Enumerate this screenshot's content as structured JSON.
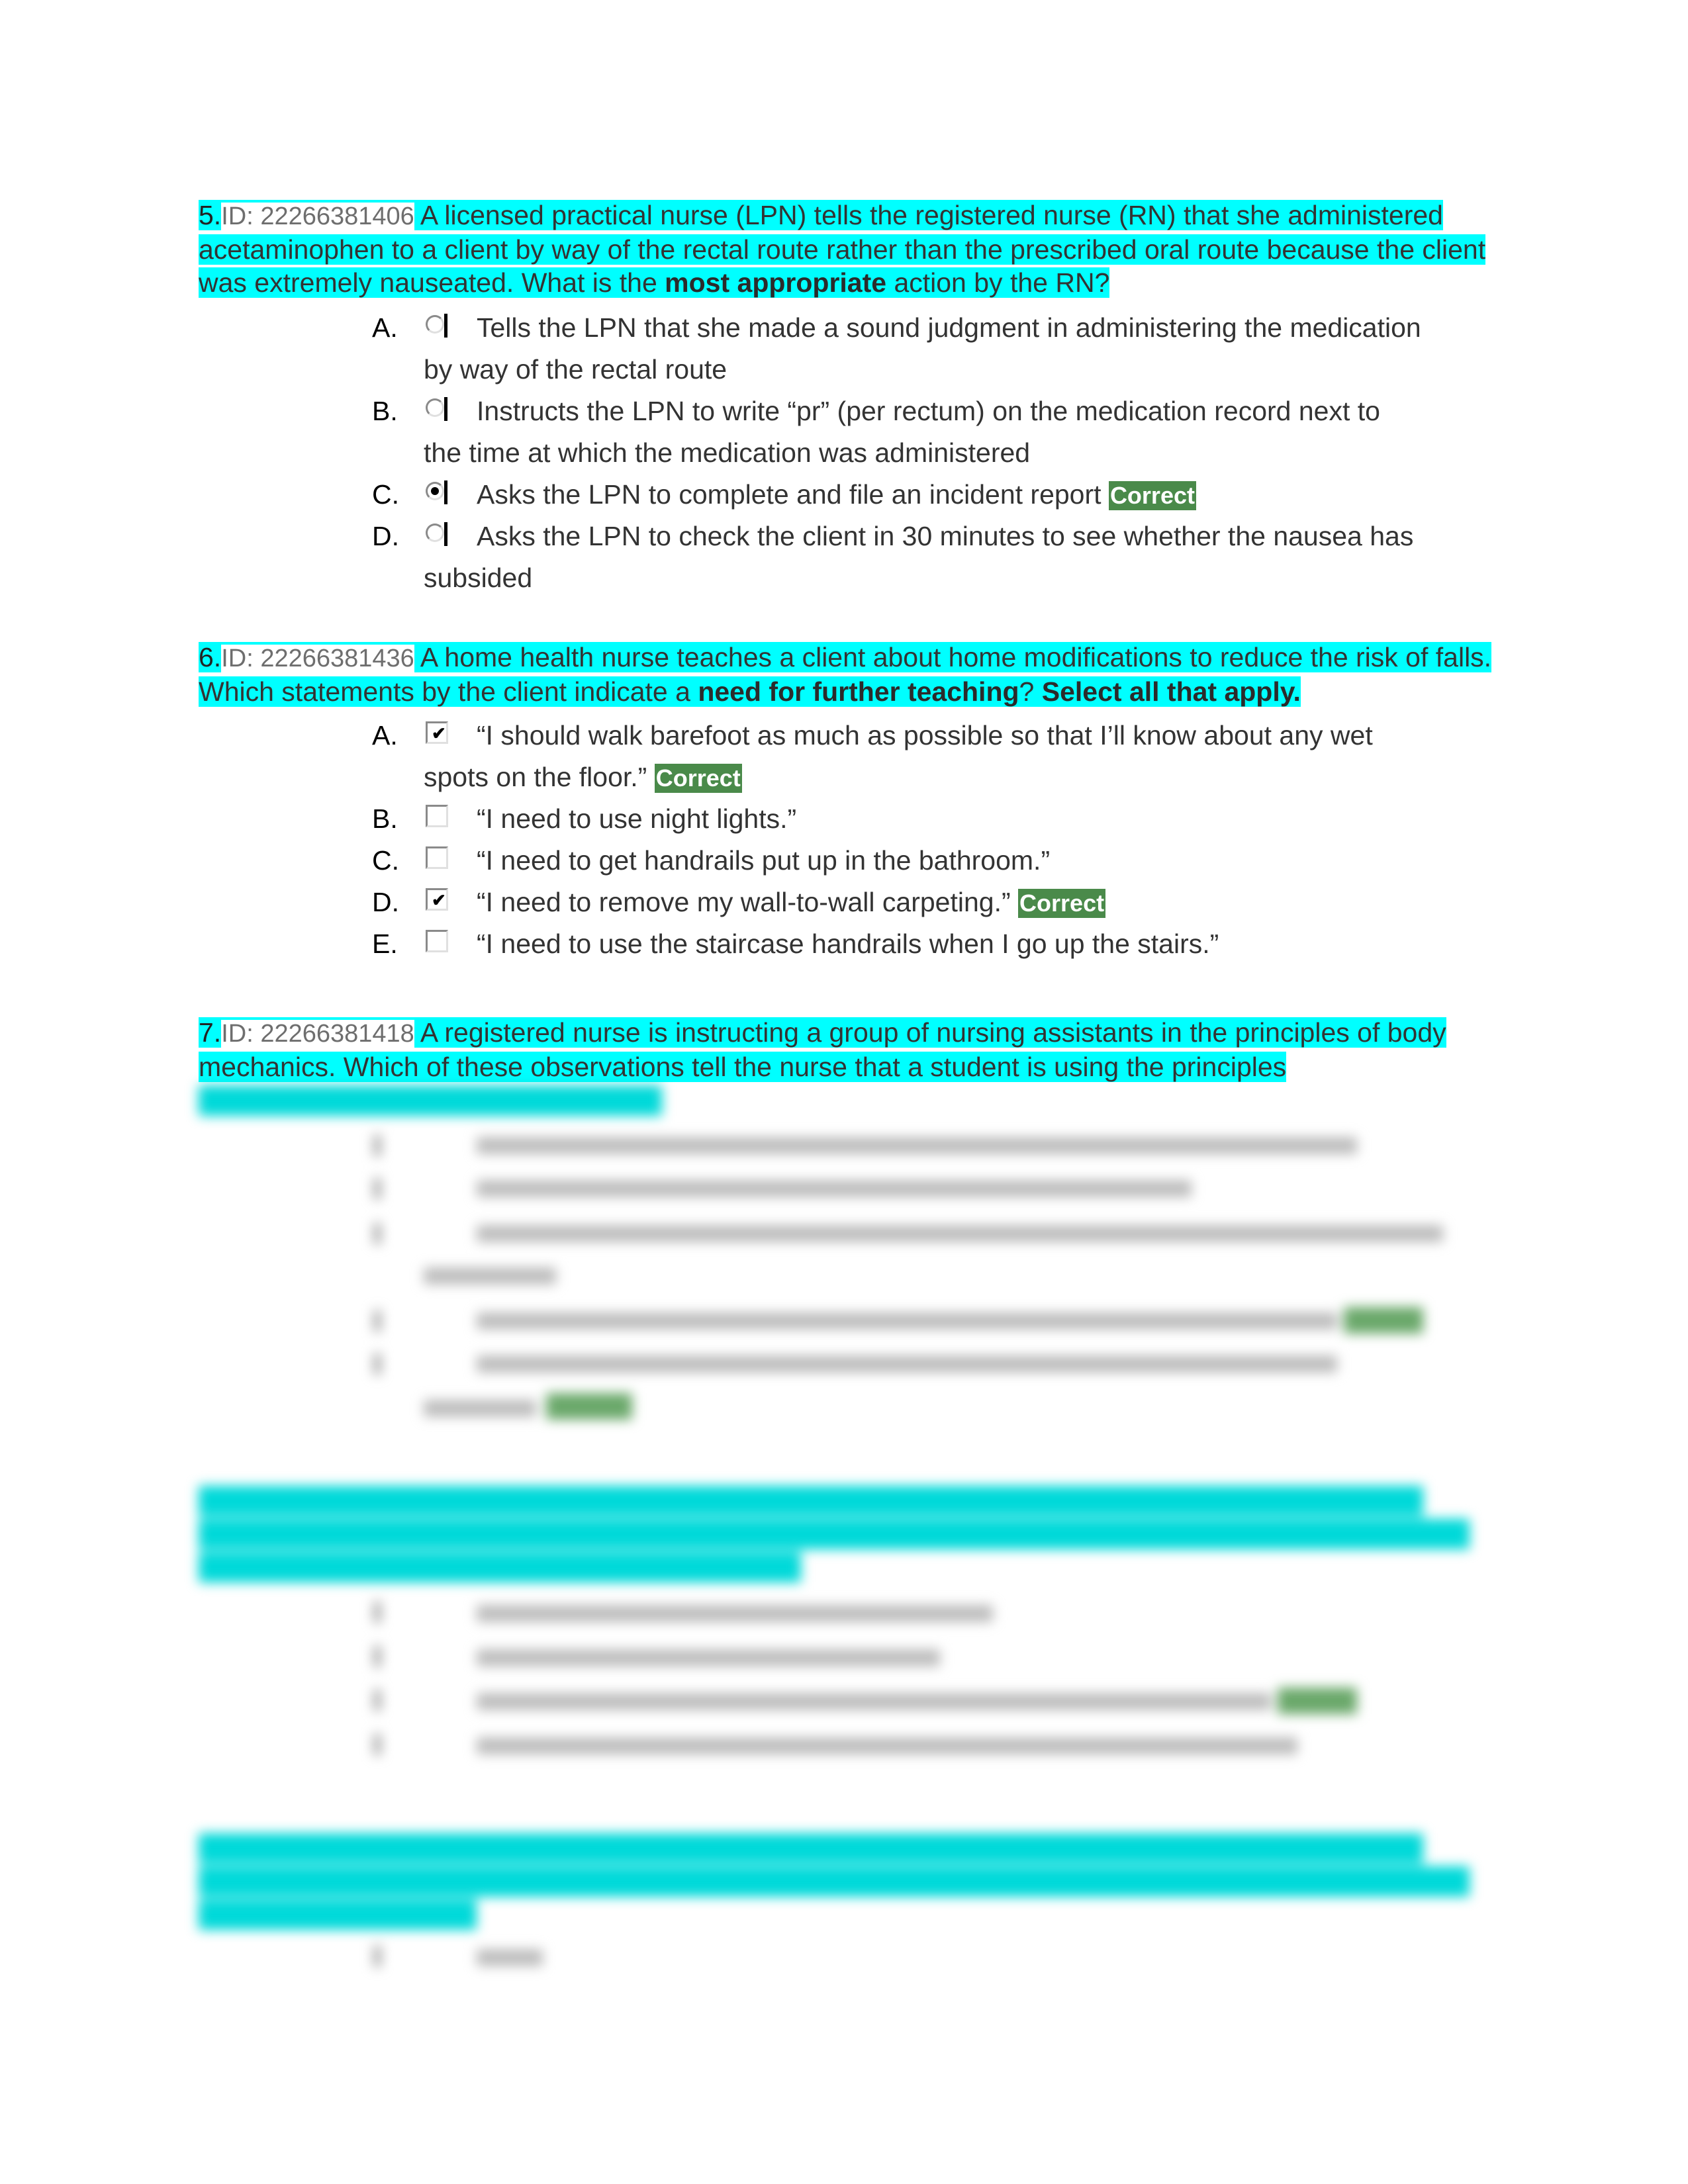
{
  "document": {
    "questions": [
      {
        "number": "5.",
        "id_label": "ID: 22266381406",
        "stem_parts": {
          "before_bold": " A licensed practical nurse (LPN) tells the registered nurse (RN) that she administered acetaminophen to a client by way of the rectal route rather than the prescribed oral route because the client was extremely nauseated. What is the ",
          "bold_1": "most appropriate",
          "after_bold": " action by the RN?"
        },
        "type": "single-choice",
        "answers": [
          {
            "letter": "A.",
            "text": "Tells the LPN that she made a sound judgment in administering the medication",
            "continuation": "by way of the rectal route",
            "selected": false,
            "correct": false
          },
          {
            "letter": "B.",
            "text": "Instructs the LPN to write “pr” (per rectum) on the medication record next to",
            "continuation": "the time at which the medication was administered",
            "selected": false,
            "correct": false
          },
          {
            "letter": "C.",
            "text": "Asks the LPN to complete and file an incident report",
            "continuation": "",
            "selected": true,
            "correct": true
          },
          {
            "letter": "D.",
            "text": "Asks the LPN to check the client in 30 minutes to see whether the nausea has",
            "continuation": "subsided",
            "selected": false,
            "correct": false
          }
        ]
      },
      {
        "number": "6.",
        "id_label": "ID: 22266381436",
        "stem_parts": {
          "before_bold": " A home health nurse teaches a client about home modifications to reduce the risk of falls. Which statements by the client indicate a ",
          "bold_1": "need for further teaching",
          "middle": "? ",
          "bold_2": "Select all that apply."
        },
        "type": "multi-select",
        "answers": [
          {
            "letter": "A.",
            "text": "“I should walk barefoot as much as possible so that I’ll know about any wet",
            "continuation": "spots on the floor.”",
            "selected": true,
            "correct": true
          },
          {
            "letter": "B.",
            "text": "“I need to use night lights.”",
            "continuation": "",
            "selected": false,
            "correct": false
          },
          {
            "letter": "C.",
            "text": "“I need to get handrails put up in the bathroom.”",
            "continuation": "",
            "selected": false,
            "correct": false
          },
          {
            "letter": "D.",
            "text": "“I need to remove my wall-to-wall carpeting.”",
            "continuation": "",
            "selected": true,
            "correct": true
          },
          {
            "letter": "E.",
            "text": "“I need to use the staircase handrails when I go up the stairs.”",
            "continuation": "",
            "selected": false,
            "correct": false
          }
        ]
      },
      {
        "number": "7.",
        "id_label": "ID: 22266381418",
        "stem_parts": {
          "before_bold": " A registered nurse is instructing a group of nursing assistants in the principles of body mechanics. Which of these observations tell the nurse that a student is using the principles"
        },
        "type": "multi-select",
        "answers_obscured": true
      }
    ],
    "correct_badge_label": "Correct",
    "colors": {
      "highlight": "#00ffff",
      "correct_badge": "#4a8a4a",
      "id_text": "#6e6e6e",
      "body_text": "#333333"
    }
  }
}
